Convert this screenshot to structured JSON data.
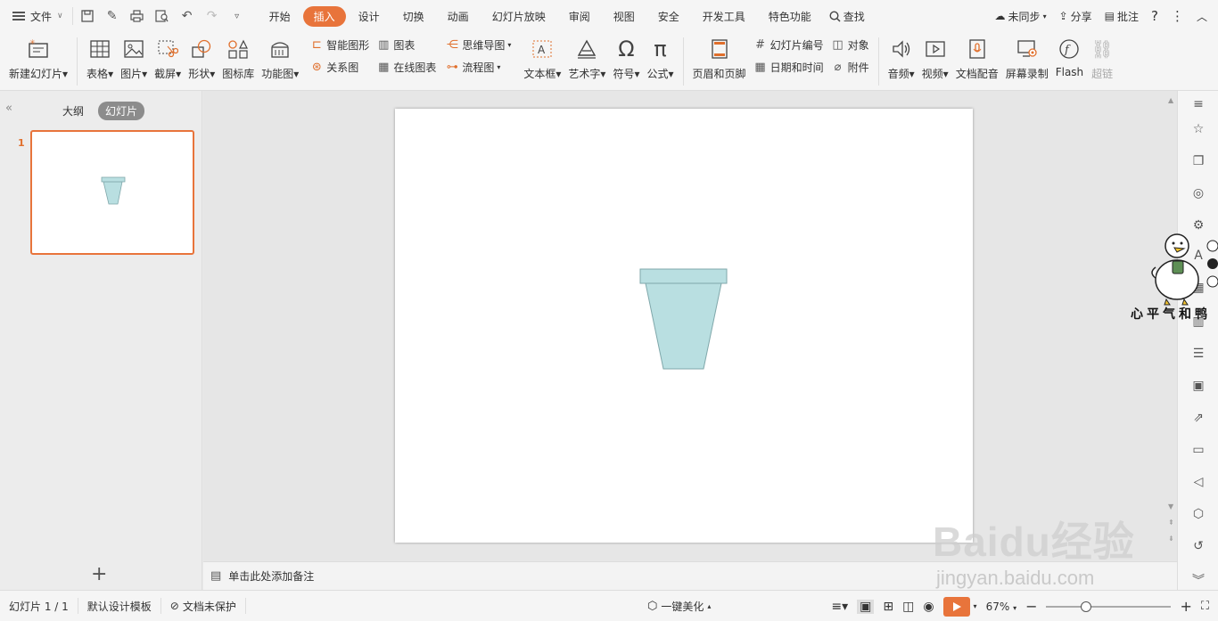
{
  "menu": {
    "file_label": "文件",
    "tabs": [
      "开始",
      "插入",
      "设计",
      "切换",
      "动画",
      "幻灯片放映",
      "审阅",
      "视图",
      "安全",
      "开发工具",
      "特色功能"
    ],
    "active_tab": "插入",
    "search_label": "查找",
    "sync_label": "未同步",
    "share_label": "分享",
    "comment_label": "批注",
    "help_label": "?"
  },
  "ribbon": {
    "new_slide": "新建幻灯片",
    "table": "表格",
    "picture": "图片",
    "screenshot": "截屏",
    "shape": "形状",
    "icon_lib": "图标库",
    "func_chart": "功能图",
    "smart_art": "智能图形",
    "chart": "图表",
    "relation": "关系图",
    "online_chart": "在线图表",
    "mind_map": "思维导图",
    "flowchart": "流程图",
    "textbox": "文本框",
    "wordart": "艺术字",
    "symbol": "符号",
    "formula": "公式",
    "header_footer": "页眉和页脚",
    "slide_number": "幻灯片编号",
    "date_time": "日期和时间",
    "object": "对象",
    "attachment": "附件",
    "audio": "音频",
    "video": "视频",
    "doc_voice": "文档配音",
    "screen_record": "屏幕录制",
    "flash": "Flash",
    "hyperlink": "超链"
  },
  "left_panel": {
    "outline_tab": "大纲",
    "slides_tab": "幻灯片",
    "slide_number": "1"
  },
  "notes": {
    "placeholder": "单击此处添加备注"
  },
  "status": {
    "slide_info": "幻灯片 1 / 1",
    "template": "默认设计模板",
    "protection": "文档未保护",
    "beautify": "一键美化",
    "zoom": "67%",
    "zoom_fraction": 0.32
  },
  "watermark": {
    "duck_caption": "心平气和鸭",
    "baidu_logo": "Baidu经验",
    "baidu_url": "jingyan.baidu.com"
  },
  "colors": {
    "accent": "#e8743b",
    "pot_fill": "#b9dfe1",
    "pot_stroke": "#7fa7aa"
  }
}
